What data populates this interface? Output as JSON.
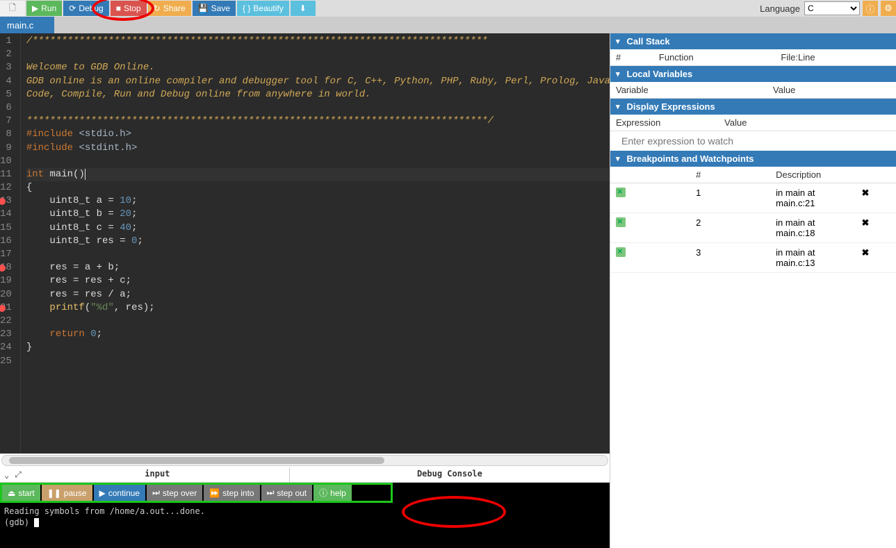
{
  "toolbar": {
    "run": "Run",
    "debug": "Debug",
    "stop": "Stop",
    "share": "Share",
    "save": "Save",
    "beautify": "Beautify",
    "language_label": "Language",
    "language_value": "C"
  },
  "filetab": "main.c",
  "code": {
    "lines": [
      "/******************************************************************************",
      "",
      "Welcome to GDB Online.",
      "GDB online is an online compiler and debugger tool for C, C++, Python, PHP, Ruby, Perl, Prolog, Javascr",
      "Code, Compile, Run and Debug online from anywhere in world.",
      "",
      "*******************************************************************************/",
      "#include <stdio.h>",
      "#include <stdint.h>",
      "",
      "int main()",
      "{",
      "    uint8_t a = 10;",
      "    uint8_t b = 20;",
      "    uint8_t c = 40;",
      "    uint8_t res = 0;",
      "",
      "    res = a + b;",
      "    res = res + c;",
      "    res = res / a;",
      "    printf(\"%d\", res);",
      "",
      "    return 0;",
      "}",
      ""
    ],
    "breakpoint_lines": [
      13,
      18,
      21
    ]
  },
  "bottom": {
    "input_label": "input",
    "console_label": "Debug Console"
  },
  "debug_buttons": {
    "start": "start",
    "pause": "pause",
    "continue": "continue",
    "step_over": "step over",
    "step_into": "step into",
    "step_out": "step out",
    "help": "help"
  },
  "console_output": "Reading symbols from /home/a.out...done.\n(gdb) ",
  "panels": {
    "callstack": {
      "title": "Call Stack",
      "cols": [
        "#",
        "Function",
        "File:Line"
      ]
    },
    "locals": {
      "title": "Local Variables",
      "cols": [
        "Variable",
        "Value"
      ]
    },
    "display": {
      "title": "Display Expressions",
      "cols": [
        "Expression",
        "Value"
      ],
      "placeholder": "Enter expression to watch"
    },
    "breakpoints": {
      "title": "Breakpoints and Watchpoints",
      "cols": [
        "",
        "#",
        "Description",
        ""
      ],
      "rows": [
        {
          "n": "1",
          "desc": "in main at main.c:21"
        },
        {
          "n": "2",
          "desc": "in main at main.c:18"
        },
        {
          "n": "3",
          "desc": "in main at main.c:13"
        }
      ]
    }
  }
}
